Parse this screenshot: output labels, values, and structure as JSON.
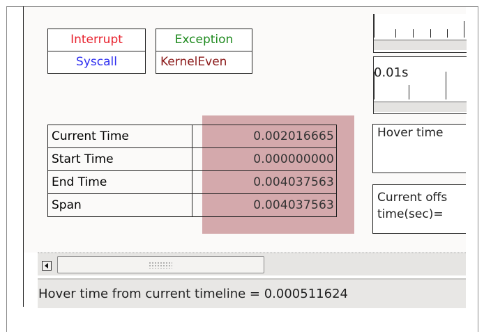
{
  "legend": {
    "interrupt": {
      "label": "Interrupt",
      "color": "#e8222e"
    },
    "syscall": {
      "label": "Syscall",
      "color": "#2f2ff0"
    },
    "exception": {
      "label": "Exception",
      "color": "#1f8a1f"
    },
    "kernel_event": {
      "label": "KernelEven",
      "color": "#8b1a1a"
    }
  },
  "timeline": {
    "scale_label": "0.01s"
  },
  "time_table": {
    "rows": [
      {
        "label": "Current Time",
        "value": "0.002016665"
      },
      {
        "label": "Start Time",
        "value": "0.000000000"
      },
      {
        "label": "End Time",
        "value": "0.004037563"
      },
      {
        "label": "Span",
        "value": "0.004037563"
      }
    ]
  },
  "hover_box": {
    "text": "Hover time"
  },
  "offset_box": {
    "line1": "Current offs",
    "line2": "time(sec)="
  },
  "status_bar": {
    "text": "Hover time from current timeline = 0.000511624"
  }
}
